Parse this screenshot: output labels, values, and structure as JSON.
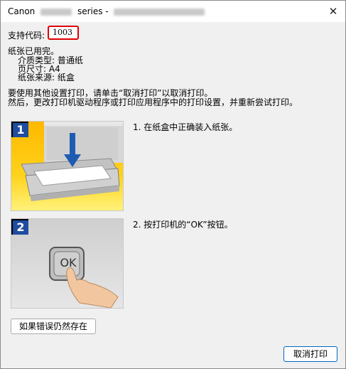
{
  "window": {
    "title_prefix": "Canon",
    "title_series": "series -",
    "close_glyph": "✕"
  },
  "support": {
    "label": "支持代码:",
    "code": "1003"
  },
  "paper": {
    "heading": "纸张已用完。",
    "media_type": "介质类型:  普通纸",
    "page_size": "页尺寸:  A4",
    "source": "纸张来源:  纸盒"
  },
  "instructions": {
    "line1": "要使用其他设置打印，请单击“取消打印”以取消打印。",
    "line2": "然后，更改打印机驱动程序或打印应用程序中的打印设置，并重新尝试打印。"
  },
  "steps": [
    {
      "badge": "1",
      "text": "1.  在纸盒中正确装入纸张。"
    },
    {
      "badge": "2",
      "text": "2.  按打印机的“OK”按钮。",
      "button_glyph": "OK"
    }
  ],
  "buttons": {
    "still_error": "如果错误仍然存在",
    "cancel_print": "取消打印"
  },
  "colors": {
    "accent": "#0067c0",
    "highlight_border": "#e00000",
    "step_badge": "#1e4ca0"
  }
}
